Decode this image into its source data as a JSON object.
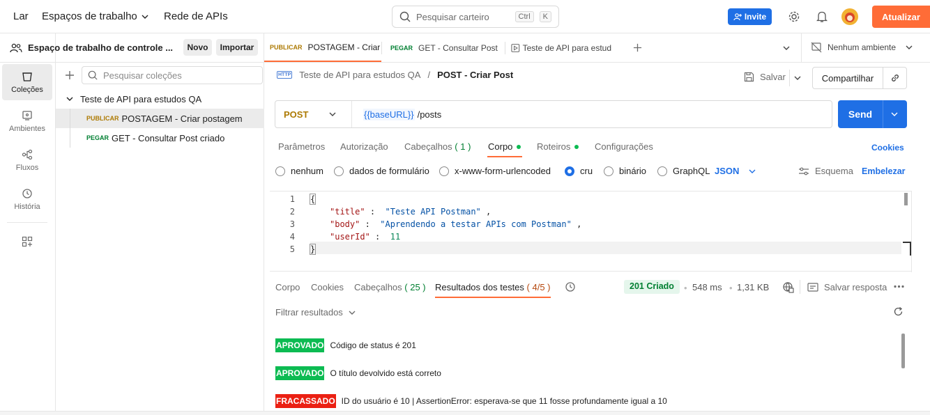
{
  "topbar": {
    "home": "Lar",
    "workspaces": "Espaços de trabalho",
    "api_network": "Rede de APIs",
    "search_placeholder": "Pesquisar carteiro",
    "kbd_ctrl": "Ctrl",
    "kbd_k": "K",
    "invite": "Invite",
    "update": "Atualizar"
  },
  "rail": [
    "Coleções",
    "Ambientes",
    "Fluxos",
    "História"
  ],
  "workspace": {
    "title": "Espaço de trabalho de controle ...",
    "new": "Novo",
    "import": "Importar"
  },
  "sidebar": {
    "search_placeholder": "Pesquisar coleções",
    "collection": "Teste de API para estudos QA",
    "items": [
      {
        "method": "PUBLICAR",
        "name": "POSTAGEM - Criar postagem"
      },
      {
        "method": "PEGAR",
        "name": "GET - Consultar Post criado"
      }
    ]
  },
  "tabs": [
    {
      "method": "PUBLICAR",
      "name": "POSTAGEM - Criar"
    },
    {
      "method": "PEGAR",
      "name": "GET - Consultar Post c"
    },
    {
      "method": "",
      "name": "Teste de API para estud"
    }
  ],
  "environment": "Nenhum ambiente",
  "breadcrumb": {
    "parent": "Teste de API para estudos QA",
    "sep": "/",
    "current": "POST - Criar Post"
  },
  "actions": {
    "save": "Salvar",
    "share": "Compartilhar"
  },
  "request": {
    "method": "POST",
    "url_var": "{{baseURL}}",
    "url_path": "/posts",
    "send": "Send"
  },
  "req_tabs": {
    "params": "Parâmetros",
    "auth": "Autorização",
    "headers": "Cabeçalhos",
    "headers_count": "( 1 )",
    "body": "Corpo",
    "scripts": "Roteiros",
    "settings": "Configurações",
    "cookies": "Cookies"
  },
  "body_types": {
    "none": "nenhum",
    "form": "dados de formulário",
    "urlenc": "x-www-form-urlencoded",
    "raw": "cru",
    "binary": "binário",
    "graphql": "GraphQL",
    "format": "JSON",
    "schema": "Esquema",
    "beautify": "Embelezar"
  },
  "code": {
    "lines": [
      "1",
      "2",
      "3",
      "4",
      "5"
    ],
    "open": "{",
    "k1": "\"title\"",
    "v1": "\"Teste API Postman\"",
    "k2": "\"body\"",
    "v2": "\"Aprendendo a testar APIs com Postman\"",
    "k3": "\"userId\"",
    "v3": "11",
    "colon": ":",
    "comma": ",",
    "close": "}"
  },
  "response": {
    "body": "Corpo",
    "cookies": "Cookies",
    "headers": "Cabeçalhos",
    "headers_count": "( 25 )",
    "tests": "Resultados dos testes",
    "tests_count": "( 4/5 )",
    "status": "201 Criado",
    "time": "548 ms",
    "size": "1,31 KB",
    "save": "Salvar resposta",
    "filter": "Filtrar resultados"
  },
  "results": [
    {
      "status": "APROVADO",
      "text": "Código de status é 201",
      "color": "#0cbb52"
    },
    {
      "status": "APROVADO",
      "text": "O título devolvido está correto",
      "color": "#0cbb52"
    },
    {
      "status": "FRACASSADO",
      "text": "ID do usuário é 10 | AssertionError: esperava-se que 11 fosse profundamente igual a 10",
      "color": "#eb2013"
    }
  ],
  "colors": {
    "accent": "#ff6c37",
    "primary": "#1f6fe5",
    "pass": "#0cbb52",
    "fail": "#eb2013",
    "post": "#ad7a03",
    "get": "#007f31"
  }
}
